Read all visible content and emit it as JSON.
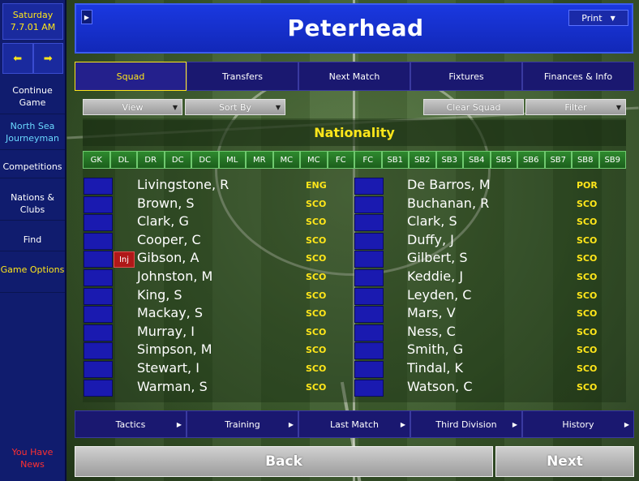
{
  "sidebar": {
    "day": "Saturday",
    "date": "7.7.01 AM",
    "back_arrow": "⬅",
    "forward_arrow": "➡",
    "items": [
      {
        "label": "Continue Game"
      },
      {
        "label": "North Sea Journeyman"
      },
      {
        "label": "Competitions"
      },
      {
        "label": "Nations & Clubs"
      },
      {
        "label": "Find"
      },
      {
        "label": "Game Options"
      }
    ],
    "news": "You Have News"
  },
  "header": {
    "title": "Peterhead",
    "print_label": "Print"
  },
  "tabs": [
    {
      "label": "Squad",
      "active": true
    },
    {
      "label": "Transfers"
    },
    {
      "label": "Next Match"
    },
    {
      "label": "Fixtures"
    },
    {
      "label": "Finances & Info"
    }
  ],
  "toolbar": {
    "view_label": "View",
    "sortby_label": "Sort By",
    "clear_label": "Clear Squad",
    "filter_label": "Filter"
  },
  "panel": {
    "title": "Nationality",
    "positions": [
      "GK",
      "DL",
      "DR",
      "DC",
      "DC",
      "ML",
      "MR",
      "MC",
      "MC",
      "FC",
      "FC",
      "SB1",
      "SB2",
      "SB3",
      "SB4",
      "SB5",
      "SB6",
      "SB7",
      "SB8",
      "SB9"
    ]
  },
  "players_left": [
    {
      "name": "Livingstone, R",
      "nat": "ENG"
    },
    {
      "name": "Brown, S",
      "nat": "SCO"
    },
    {
      "name": "Clark, G",
      "nat": "SCO"
    },
    {
      "name": "Cooper, C",
      "nat": "SCO"
    },
    {
      "name": "Gibson, A",
      "nat": "SCO",
      "status": "Inj"
    },
    {
      "name": "Johnston, M",
      "nat": "SCO"
    },
    {
      "name": "King, S",
      "nat": "SCO"
    },
    {
      "name": "Mackay, S",
      "nat": "SCO"
    },
    {
      "name": "Murray, I",
      "nat": "SCO"
    },
    {
      "name": "Simpson, M",
      "nat": "SCO"
    },
    {
      "name": "Stewart, I",
      "nat": "SCO"
    },
    {
      "name": "Warman, S",
      "nat": "SCO"
    }
  ],
  "players_right": [
    {
      "name": "De Barros, M",
      "nat": "POR"
    },
    {
      "name": "Buchanan, R",
      "nat": "SCO"
    },
    {
      "name": "Clark, S",
      "nat": "SCO"
    },
    {
      "name": "Duffy, J",
      "nat": "SCO"
    },
    {
      "name": "Gilbert, S",
      "nat": "SCO"
    },
    {
      "name": "Keddie, J",
      "nat": "SCO"
    },
    {
      "name": "Leyden, C",
      "nat": "SCO"
    },
    {
      "name": "Mars, V",
      "nat": "SCO"
    },
    {
      "name": "Ness, C",
      "nat": "SCO"
    },
    {
      "name": "Smith, G",
      "nat": "SCO"
    },
    {
      "name": "Tindal, K",
      "nat": "SCO"
    },
    {
      "name": "Watson, C",
      "nat": "SCO"
    }
  ],
  "bottom_nav": [
    {
      "label": "Tactics"
    },
    {
      "label": "Training"
    },
    {
      "label": "Last Match"
    },
    {
      "label": "Third Division"
    },
    {
      "label": "History"
    }
  ],
  "footer": {
    "back_label": "Back",
    "next_label": "Next"
  }
}
